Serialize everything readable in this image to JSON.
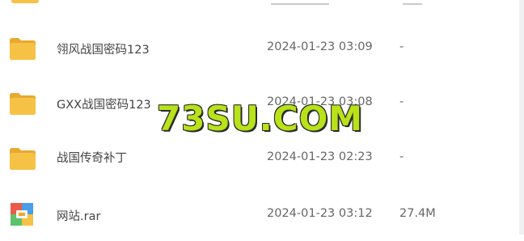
{
  "files": [
    {
      "name": "翎风战国密码123",
      "time": "2024-01-23 03:09",
      "size": "-",
      "icon": "folder-icon"
    },
    {
      "name": "GXX战国密码123",
      "time": "2024-01-23 03:08",
      "size": "-",
      "icon": "folder-icon"
    },
    {
      "name": "战国传奇补丁",
      "time": "2024-01-23 02:23",
      "size": "-",
      "icon": "folder-icon"
    },
    {
      "name": "网站.rar",
      "time": "2024-01-23 03:12",
      "size": "27.4M",
      "icon": "archive-icon"
    }
  ],
  "watermark": "73SU.COM",
  "colors": {
    "folder": "#f5c246",
    "folder_dark": "#e8a92f",
    "watermark": "#b8e21a"
  }
}
